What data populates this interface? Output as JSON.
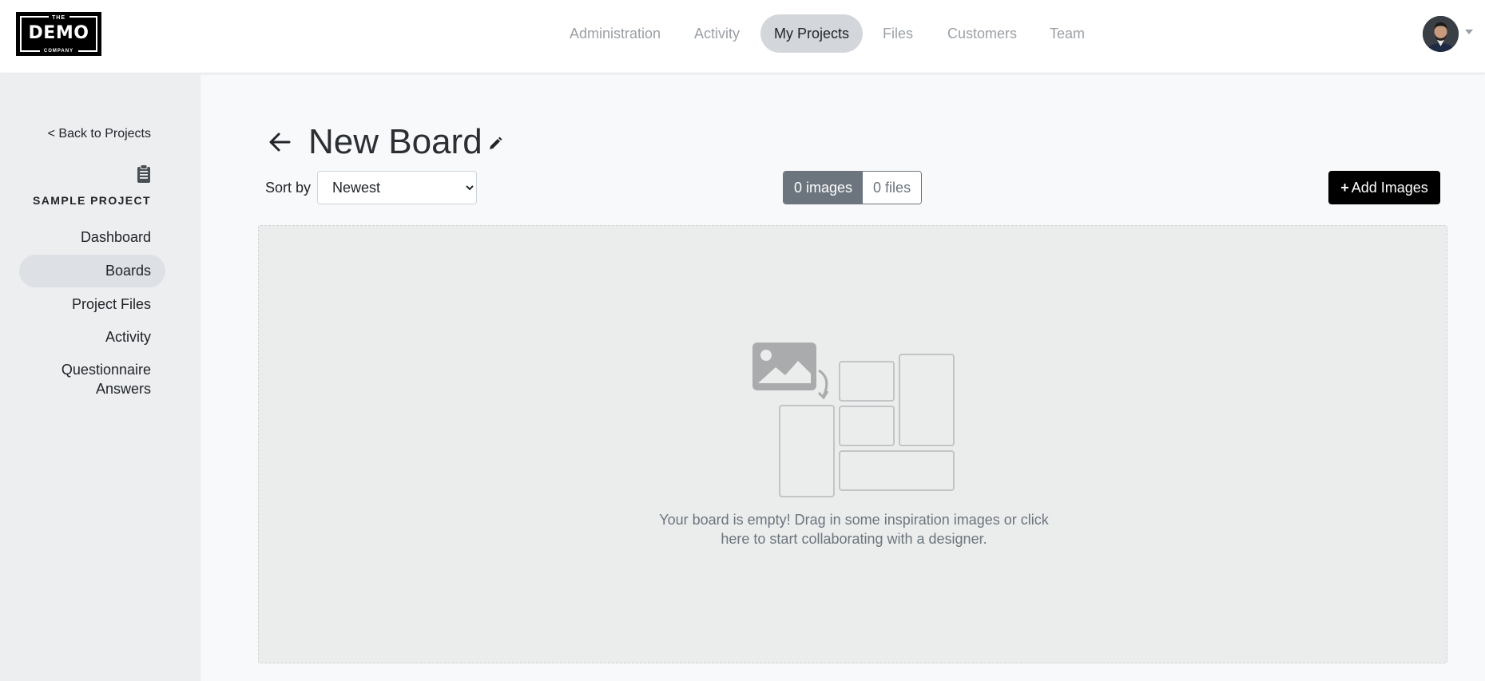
{
  "header": {
    "logo": {
      "top": "THE",
      "main": "DEMO",
      "bottom": "COMPANY"
    },
    "nav": [
      {
        "label": "Administration",
        "active": false
      },
      {
        "label": "Activity",
        "active": false
      },
      {
        "label": "My Projects",
        "active": true
      },
      {
        "label": "Files",
        "active": false
      },
      {
        "label": "Customers",
        "active": false
      },
      {
        "label": "Team",
        "active": false
      }
    ]
  },
  "sidebar": {
    "back_label": "< Back to Projects",
    "project_icon": "clipboard-icon",
    "project_name": "SAMPLE PROJECT",
    "items": [
      {
        "label": "Dashboard",
        "active": false
      },
      {
        "label": "Boards",
        "active": true
      },
      {
        "label": "Project Files",
        "active": false
      },
      {
        "label": "Activity",
        "active": false
      },
      {
        "label": "Questionnaire Answers",
        "active": false
      }
    ]
  },
  "board": {
    "title": "New Board",
    "sort_label": "Sort by",
    "sort_selected": "Newest",
    "tabs": [
      {
        "label": "0 images",
        "active": true
      },
      {
        "label": "0 files",
        "active": false
      }
    ],
    "add_button": {
      "icon": "plus-icon",
      "label": "Add Images"
    },
    "empty_message": "Your board is empty! Drag in some inspiration images or click here to start collaborating with a designer."
  },
  "colors": {
    "accent": "#000000",
    "nav_active_bg": "#d3d6db",
    "segment_active": "#6c757d",
    "sidebar_bg": "#eceef0"
  }
}
